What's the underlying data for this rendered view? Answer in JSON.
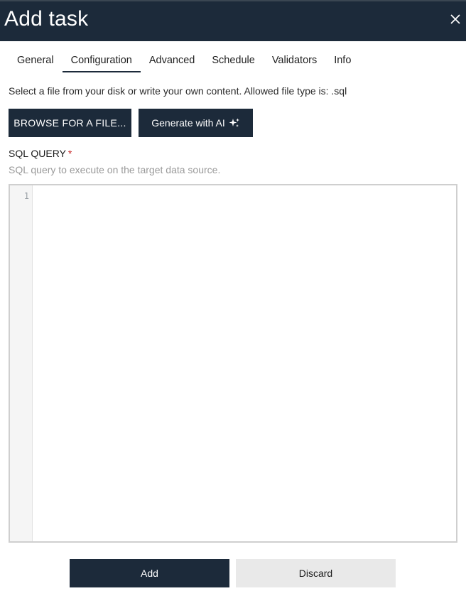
{
  "dialog": {
    "title": "Add task"
  },
  "tabs": [
    {
      "label": "General"
    },
    {
      "label": "Configuration",
      "active": true
    },
    {
      "label": "Advanced"
    },
    {
      "label": "Schedule"
    },
    {
      "label": "Validators"
    },
    {
      "label": "Info"
    }
  ],
  "file_section": {
    "hint": "Select a file from your disk or write your own content. Allowed file type is: .sql",
    "browse_label": "BROWSE FOR A FILE...",
    "generate_label": "Generate with AI"
  },
  "sql_field": {
    "label": "SQL QUERY",
    "required_marker": "*",
    "help": "SQL query to execute on the target data source.",
    "line_number": "1",
    "value": ""
  },
  "footer": {
    "add_label": "Add",
    "discard_label": "Discard"
  },
  "colors": {
    "primary": "#1c2a3a",
    "required": "#c62828",
    "secondary_button": "#e9e9e9"
  },
  "icons": {
    "close": "close-icon",
    "ai": "sparkles-icon"
  }
}
